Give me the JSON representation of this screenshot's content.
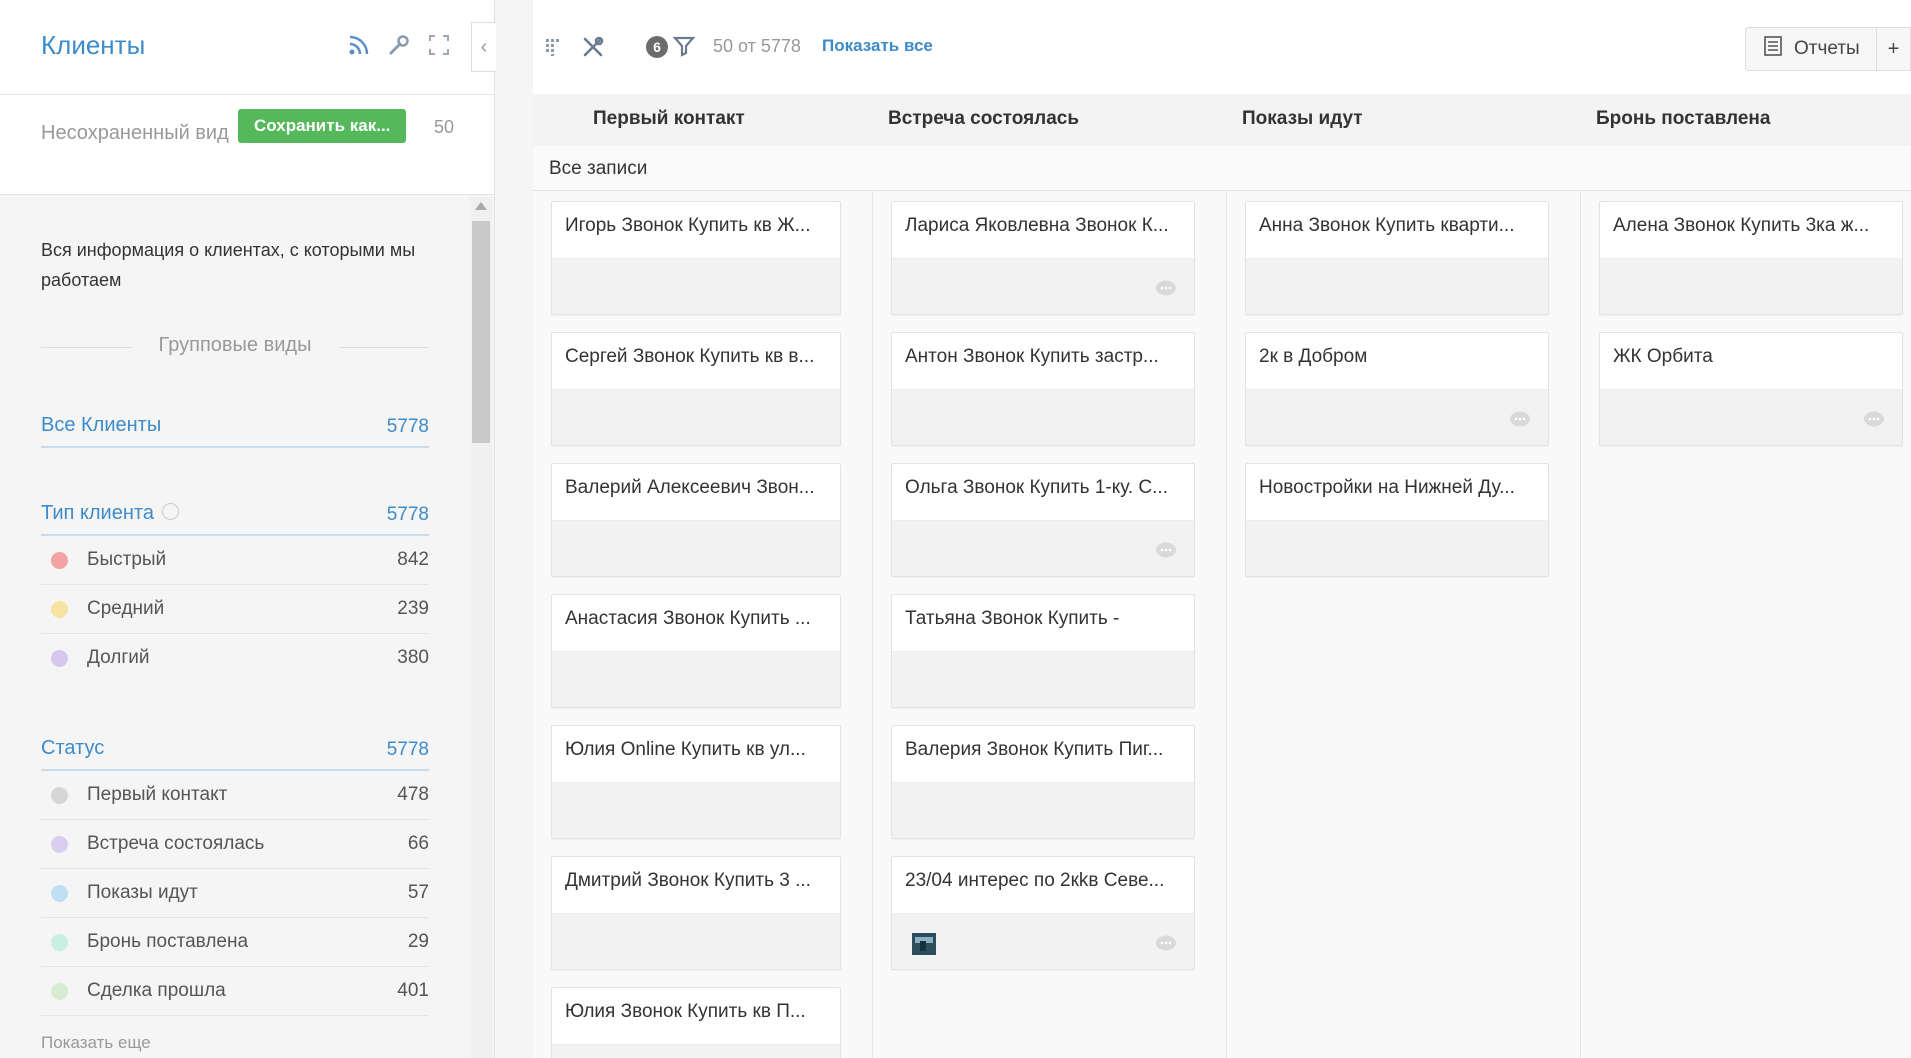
{
  "sidebar": {
    "title": "Клиенты",
    "view_label": "Несохраненный вид",
    "save_as_label": "Сохранить как...",
    "view_count": "50",
    "description": "Вся информация о клиентах, с которыми мы работаем",
    "group_views_title": "Групповые виды",
    "all_clients": {
      "label": "Все Клиенты",
      "count": "5778"
    },
    "client_type": {
      "label": "Тип клиента",
      "count": "5778",
      "items": [
        {
          "label": "Быстрый",
          "count": "842",
          "color": "#f3a3a3"
        },
        {
          "label": "Средний",
          "count": "239",
          "color": "#f6e3a1"
        },
        {
          "label": "Долгий",
          "count": "380",
          "color": "#d7c7ee"
        }
      ]
    },
    "status": {
      "label": "Статус",
      "count": "5778",
      "items": [
        {
          "label": "Первый контакт",
          "count": "478",
          "color": "#d6d6d6"
        },
        {
          "label": "Встреча состоялась",
          "count": "66",
          "color": "#d9cdf0"
        },
        {
          "label": "Показы идут",
          "count": "57",
          "color": "#bfe0f3"
        },
        {
          "label": "Бронь поставлена",
          "count": "29",
          "color": "#c8f0e1"
        },
        {
          "label": "Сделка прошла",
          "count": "401",
          "color": "#d7ecd3"
        }
      ]
    },
    "show_more": "Показать еще"
  },
  "toolbar": {
    "filter_badge": "6",
    "count_text": "50 от 5778",
    "show_all": "Показать все",
    "reports_label": "Отчеты",
    "plus_label": "+"
  },
  "board": {
    "all_records": "Все записи",
    "columns": [
      {
        "title": "Первый контакт",
        "cards": [
          {
            "title": "Игорь Звонок Купить кв Ж...",
            "comment": false
          },
          {
            "title": "Сергей Звонок Купить кв в...",
            "comment": false
          },
          {
            "title": "Валерий Алексеевич Звон...",
            "comment": false
          },
          {
            "title": "Анастасия Звонок Купить ...",
            "comment": false
          },
          {
            "title": "Юлия Online Купить кв ул...",
            "comment": false
          },
          {
            "title": "Дмитрий Звонок Купить 3 ...",
            "comment": false
          },
          {
            "title": "Юлия Звонок Купить кв П...",
            "comment": false
          }
        ]
      },
      {
        "title": "Встреча состоялась",
        "cards": [
          {
            "title": "Лариса Яковлевна Звонок К...",
            "comment": true
          },
          {
            "title": "Антон Звонок Купить застр...",
            "comment": false
          },
          {
            "title": "Ольга Звонок Купить 1-ку. С...",
            "comment": true
          },
          {
            "title": "Татьяна Звонок Купить -",
            "comment": false
          },
          {
            "title": "Валерия Звонок Купить Пиг...",
            "comment": false
          },
          {
            "title": "23/04 интерес по 2кkв Севе...",
            "comment": true,
            "photo": true
          }
        ]
      },
      {
        "title": "Показы идут",
        "cards": [
          {
            "title": "Анна Звонок Купить кварти...",
            "comment": false
          },
          {
            "title": "2к в Добром",
            "comment": true
          },
          {
            "title": "Новостройки на Нижней Ду...",
            "comment": false
          }
        ]
      },
      {
        "title": "Бронь поставлена",
        "cards": [
          {
            "title": "Алена Звонок Купить 3ка ж...",
            "comment": false
          },
          {
            "title": "ЖК Орбита",
            "comment": true
          }
        ]
      }
    ]
  }
}
